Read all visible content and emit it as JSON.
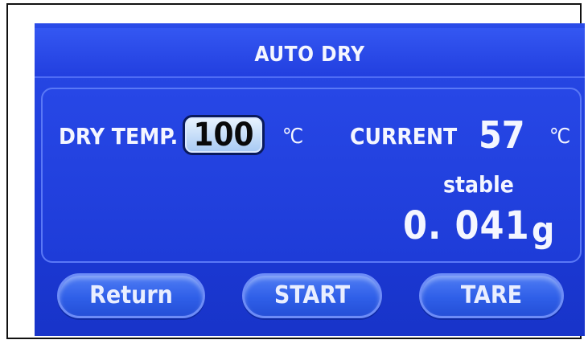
{
  "header": {
    "title": "AUTO DRY"
  },
  "settings": {
    "dry_temp_label": "DRY TEMP.",
    "dry_temp_value": "100",
    "temp_unit": "℃"
  },
  "current": {
    "label": "CURRENT",
    "temperature": "57",
    "temp_unit": "℃",
    "status": "stable",
    "weight": "0. 041",
    "weight_unit": "g"
  },
  "buttons": {
    "return_label": "Return",
    "start_label": "START",
    "tare_label": "TARE"
  },
  "colors": {
    "screen_blue": "#1f3edc",
    "text": "#f4f6ff",
    "input_bg": "#cfe3fb"
  }
}
